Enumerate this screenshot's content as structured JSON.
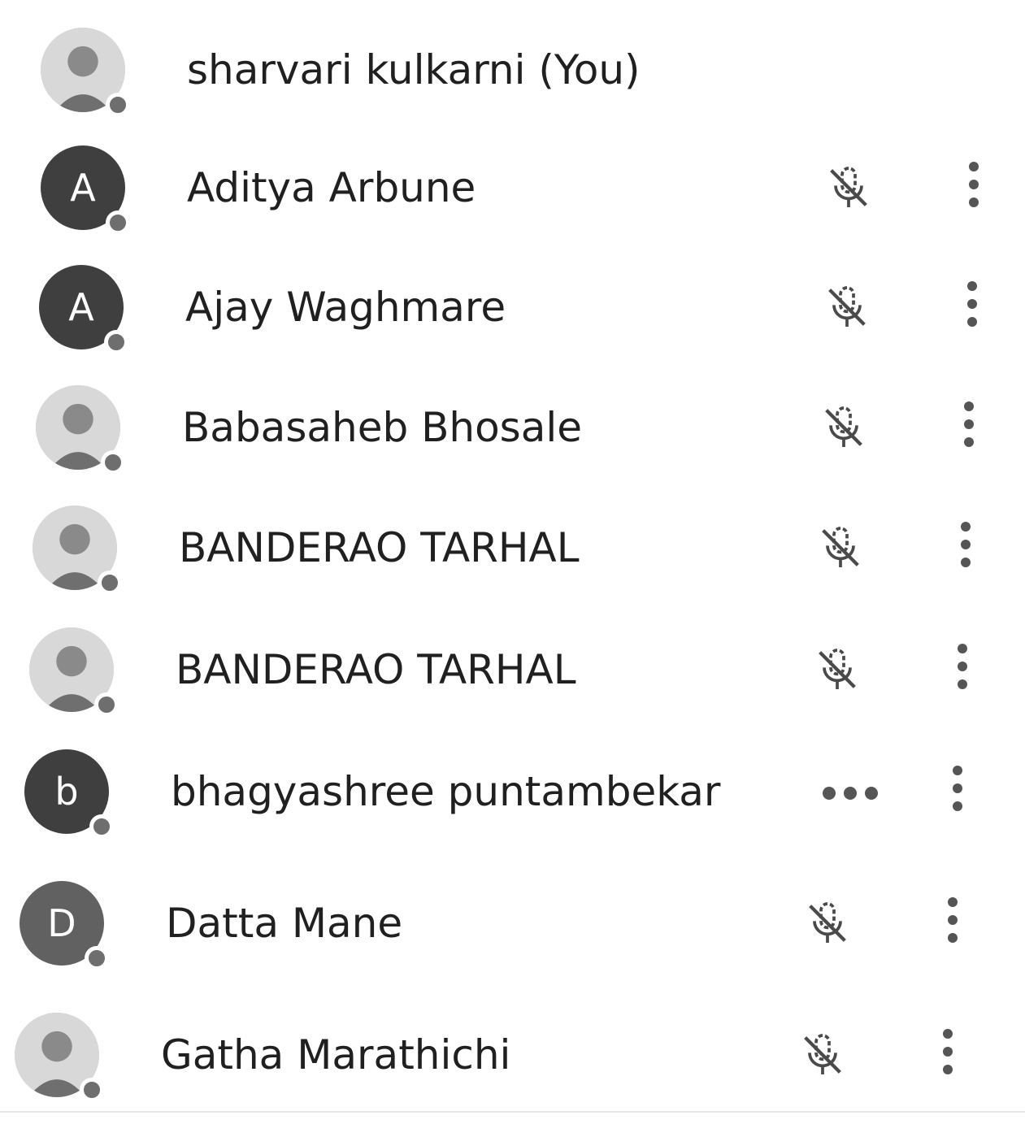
{
  "participants": [
    {
      "name": "sharvari kulkarni (You)",
      "avatar_type": "photo",
      "avatar_letter": "",
      "self": true,
      "mic_state": "none"
    },
    {
      "name": "Aditya Arbune",
      "avatar_type": "letter",
      "avatar_letter": "A",
      "self": false,
      "mic_state": "muted"
    },
    {
      "name": "Ajay Waghmare",
      "avatar_type": "letter",
      "avatar_letter": "A",
      "self": false,
      "mic_state": "muted"
    },
    {
      "name": "Babasaheb Bhosale",
      "avatar_type": "photo",
      "avatar_letter": "",
      "self": false,
      "mic_state": "muted"
    },
    {
      "name": "BANDERAO TARHAL",
      "avatar_type": "photo",
      "avatar_letter": "",
      "self": false,
      "mic_state": "muted"
    },
    {
      "name": "BANDERAO TARHAL",
      "avatar_type": "photo",
      "avatar_letter": "",
      "self": false,
      "mic_state": "muted"
    },
    {
      "name": "bhagyashree puntambekar",
      "avatar_type": "letter",
      "avatar_letter": "b",
      "self": false,
      "mic_state": "speaking"
    },
    {
      "name": "Datta Mane",
      "avatar_type": "letter",
      "avatar_letter": "D",
      "self": false,
      "mic_state": "muted"
    },
    {
      "name": "Gatha Marathichi",
      "avatar_type": "photo",
      "avatar_letter": "",
      "self": false,
      "mic_state": "muted"
    }
  ],
  "icons": {
    "mic": "mic-off-icon",
    "speaking": "speaking-dots-icon",
    "more": "more-vert-icon",
    "status": "status-dot"
  },
  "colors": {
    "text": "#202020",
    "icon": "#555555",
    "avatar_dark": "#3f3f3f",
    "avatar_light": "#616161",
    "status_dot": "#6e6e6e"
  }
}
